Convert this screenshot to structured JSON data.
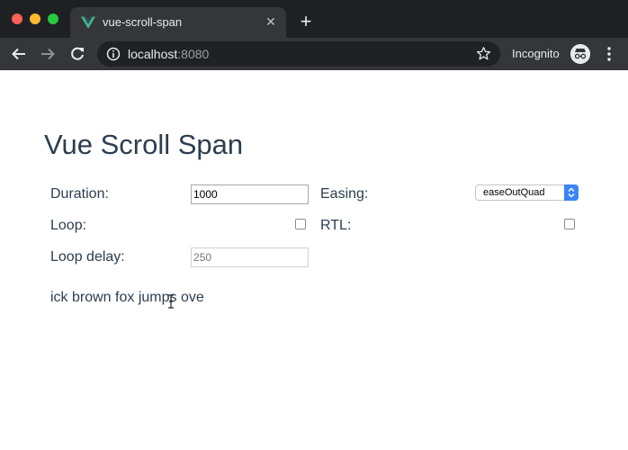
{
  "browser": {
    "tab_title": "vue-scroll-span",
    "tab_favicon": "vue-logo-icon",
    "url_host": "localhost",
    "url_port": ":8080",
    "incognito_label": "Incognito",
    "colors": {
      "titlebar": "#1f2023",
      "toolbar": "#35363a",
      "omnibox": "#202124",
      "vue_green": "#41b883",
      "close": "#fe5f57",
      "minimize": "#febc2e",
      "maximize": "#28c840"
    }
  },
  "page": {
    "title": "Vue Scroll Span",
    "text_color": "#2c3e50",
    "form": {
      "duration_label": "Duration:",
      "duration_value": "1000",
      "loop_label": "Loop:",
      "loop_checked": false,
      "loop_delay_label": "Loop delay:",
      "loop_delay_placeholder": "250",
      "easing_label": "Easing:",
      "easing_value": "easeOutQuad",
      "rtl_label": "RTL:",
      "rtl_checked": false
    },
    "scroll_text": "ick brown fox jumps ove"
  }
}
